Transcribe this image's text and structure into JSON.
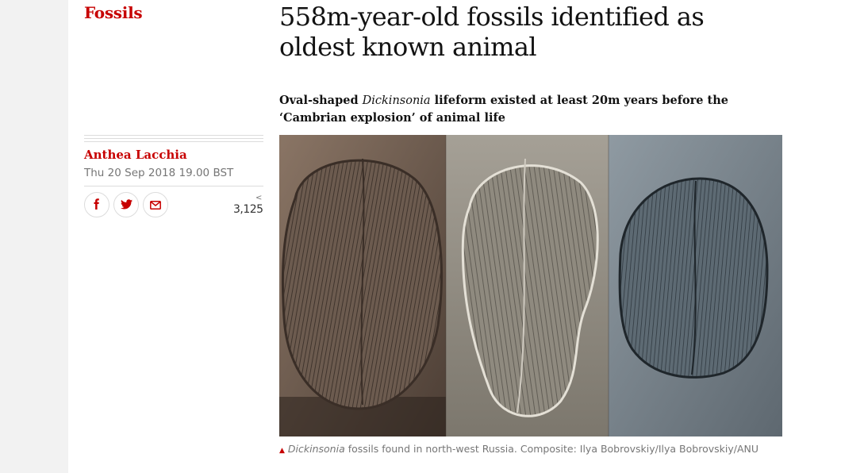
{
  "section": {
    "label": "Fossils"
  },
  "headline": {
    "line1": "558m-year-old fossils identified as",
    "line2": "oldest known animal"
  },
  "standfirst": {
    "part1": "Oval-shaped ",
    "italic": "Dickinsonia",
    "part2": " lifeform existed at least 20m years before the ‘Cambrian explosion’ of animal life"
  },
  "byline": {
    "author": "Anthea Lacchia",
    "date": "Thu 20 Sep 2018 19.00 BST"
  },
  "share": {
    "buttons": [
      {
        "icon": "facebook-icon"
      },
      {
        "icon": "twitter-icon"
      },
      {
        "icon": "email-icon"
      }
    ],
    "count": "3,125",
    "count_icon": "<"
  },
  "caption": {
    "marker": "▲",
    "italic": "Dickinsonia",
    "text": " fossils found in north-west Russia. Composite: Ilya Bobrovskiy/Ilya Bobrovskiy/ANU"
  },
  "colors": {
    "accent": "#c70000",
    "text": "#121212",
    "muted": "#767676",
    "page_background": "#f2f2f2"
  }
}
